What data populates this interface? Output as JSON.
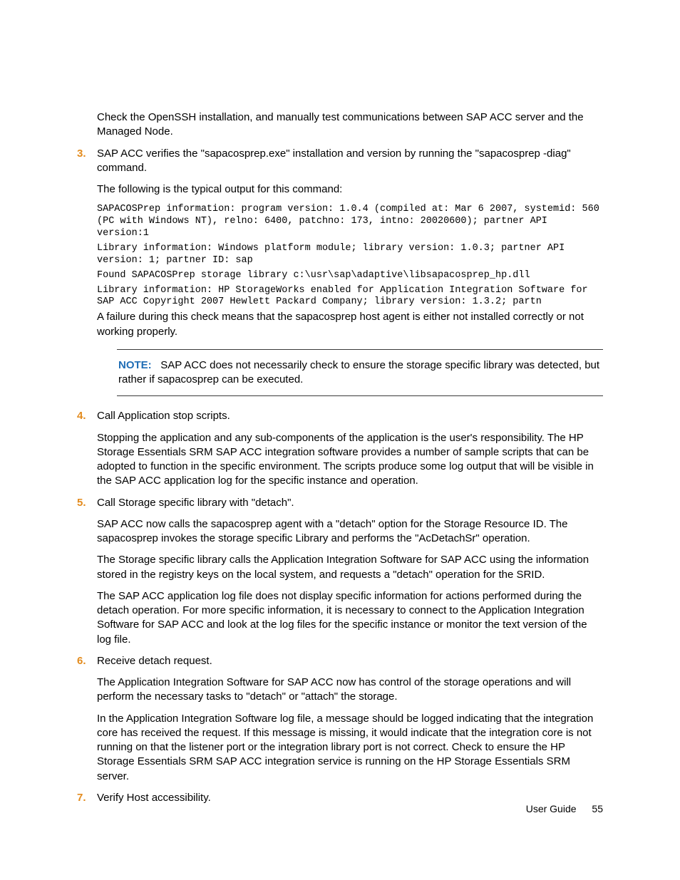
{
  "intro_para": "Check the OpenSSH installation, and manually test communications between SAP ACC server and the Managed Node.",
  "steps": {
    "s3": {
      "marker": "3.",
      "p1": "SAP ACC verifies the \"sapacosprep.exe\" installation and version by running the \"sapacosprep -diag\" command.",
      "p2": "The following is the typical output for this command:",
      "code1": "SAPACOSPrep information: program version: 1.0.4 (compiled at: Mar 6 2007, systemid: 560 (PC with Windows NT), relno: 6400, patchno: 173, intno: 20020600); partner API version:1",
      "code2": "Library information: Windows platform module; library version: 1.0.3; partner API version: 1; partner ID: sap",
      "code3": "Found SAPACOSPrep storage library c:\\usr\\sap\\adaptive\\libsapacosprep_hp.dll",
      "code4": "Library information: HP StorageWorks enabled for Application Integration Software for SAP ACC Copyright 2007 Hewlett Packard Company; library version: 1.3.2; partn",
      "p3": "A failure during this check means that the sapacosprep host agent is either not installed correctly or not working properly.",
      "note_label": "NOTE:",
      "note_body": "SAP ACC does not necessarily check to ensure the storage specific library was detected, but rather if sapacosprep can be executed."
    },
    "s4": {
      "marker": "4.",
      "p1": "Call Application stop scripts.",
      "p2": "Stopping the application and any sub-components of the application is the user's responsibility. The HP Storage Essentials SRM SAP ACC integration software provides a number of sample scripts that can be adopted to function in the specific environment. The scripts produce some log output that will be visible in the SAP ACC application log for the specific instance and operation."
    },
    "s5": {
      "marker": "5.",
      "p1": "Call Storage specific library with \"detach\".",
      "p2": "SAP ACC now calls the sapacosprep agent with a \"detach\" option for the Storage Resource ID. The sapacosprep invokes the storage specific Library and performs the \"AcDetachSr\" operation.",
      "p3": "The Storage specific library calls the Application Integration Software for SAP ACC using the information stored in the registry keys on the local system, and requests a \"detach\" operation for the SRID.",
      "p4": "The SAP ACC application log file does not display specific information for actions performed during the detach operation. For more specific information, it is necessary to connect to the Application Integration Software for SAP ACC and look at the log files for the specific instance or monitor the text version of the log file."
    },
    "s6": {
      "marker": "6.",
      "p1": "Receive detach request.",
      "p2": "The Application Integration Software for SAP ACC now has control of the storage operations and will perform the necessary tasks to \"detach\" or \"attach\" the storage.",
      "p3": "In the Application Integration Software log file, a message should be logged indicating that the integration core has received the request. If this message is missing, it would indicate that the integration core is not running on that the listener port or the integration library port is not correct. Check to ensure the HP Storage Essentials SRM SAP ACC integration service is running on the HP Storage Essentials SRM server."
    },
    "s7": {
      "marker": "7.",
      "p1": "Verify Host accessibility."
    }
  },
  "footer": {
    "title": "User Guide",
    "page": "55"
  }
}
